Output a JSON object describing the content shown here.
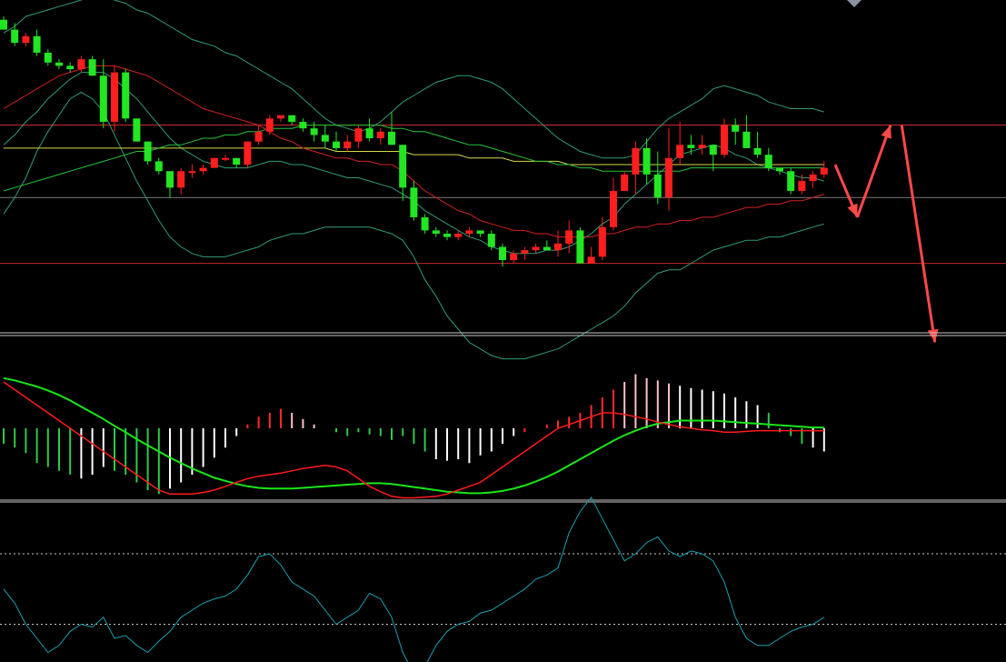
{
  "colors": {
    "background": "#000000",
    "up_candle": "#ff1e1e",
    "down_candle": "#22e622",
    "separator": "#c8c8c8",
    "horizontal_levels": "#c8282c",
    "mid_level": "#7a7a7a",
    "bollinger": "#2f9b74",
    "ma_red": "#d42020",
    "ma_green": "#22c43a",
    "ma_yellow": "#d8d84a",
    "dif": "#ff1a1a",
    "dea": "#19e619",
    "rsi": "#1aa0b0",
    "arrow": "#ff4848"
  },
  "chart_data": [
    {
      "type": "candlestick",
      "title": "",
      "xlabel": "",
      "ylabel": "",
      "ylim": [
        0,
        100
      ],
      "grid": false,
      "candles": [
        [
          94,
          91,
          95,
          91
        ],
        [
          91,
          87,
          93,
          86
        ],
        [
          87,
          89,
          90,
          86
        ],
        [
          89,
          84,
          91,
          83
        ],
        [
          84,
          81,
          85,
          80
        ],
        [
          81,
          80,
          82,
          79
        ],
        [
          80,
          79,
          81,
          78
        ],
        [
          79,
          82,
          83,
          78
        ],
        [
          82,
          77,
          83,
          77
        ],
        [
          77,
          63,
          82,
          61
        ],
        [
          63,
          78,
          80,
          60
        ],
        [
          78,
          64,
          79,
          63
        ],
        [
          64,
          57,
          64,
          57
        ],
        [
          57,
          51,
          57,
          50
        ],
        [
          51,
          48,
          52,
          47
        ],
        [
          48,
          43,
          48,
          40
        ],
        [
          43,
          48,
          49,
          41
        ],
        [
          48,
          48,
          50,
          46
        ],
        [
          48,
          49,
          50,
          47
        ],
        [
          49,
          52,
          52,
          49
        ],
        [
          52,
          52,
          53,
          51
        ],
        [
          52,
          50,
          52,
          49
        ],
        [
          50,
          57,
          57,
          49
        ],
        [
          57,
          60,
          62,
          56
        ],
        [
          60,
          64,
          65,
          59
        ],
        [
          64,
          65,
          65,
          63
        ],
        [
          65,
          63,
          65,
          62
        ],
        [
          63,
          61,
          64,
          60
        ],
        [
          61,
          59,
          63,
          57
        ],
        [
          59,
          57,
          62,
          55
        ],
        [
          57,
          55,
          60,
          54
        ],
        [
          55,
          57,
          59,
          54
        ],
        [
          57,
          61,
          62,
          55
        ],
        [
          61,
          58,
          64,
          57
        ],
        [
          58,
          60,
          61,
          56
        ],
        [
          60,
          56,
          66,
          56
        ],
        [
          56,
          43,
          56,
          39
        ],
        [
          43,
          34,
          45,
          33
        ],
        [
          34,
          30,
          35,
          29
        ],
        [
          30,
          29,
          31,
          28
        ],
        [
          29,
          28,
          30,
          27
        ],
        [
          28,
          29,
          30,
          27
        ],
        [
          29,
          30,
          31,
          28
        ],
        [
          30,
          29,
          30,
          28
        ],
        [
          29,
          25,
          30,
          24
        ],
        [
          25,
          21,
          26,
          19
        ],
        [
          21,
          23,
          24,
          20
        ],
        [
          23,
          24,
          25,
          21
        ],
        [
          24,
          25,
          26,
          23
        ],
        [
          25,
          24,
          27,
          24
        ],
        [
          24,
          26,
          30,
          22
        ],
        [
          26,
          30,
          33,
          23
        ],
        [
          30,
          20,
          31,
          20
        ],
        [
          20,
          22,
          25,
          22
        ],
        [
          22,
          31,
          34,
          21
        ],
        [
          31,
          42,
          46,
          30
        ],
        [
          42,
          47,
          48,
          43
        ],
        [
          47,
          55,
          57,
          41
        ],
        [
          55,
          47,
          58,
          44
        ],
        [
          47,
          40,
          54,
          38
        ],
        [
          40,
          52,
          61,
          36
        ],
        [
          52,
          56,
          63,
          50
        ],
        [
          56,
          55,
          59,
          53
        ],
        [
          55,
          56,
          59,
          53
        ],
        [
          56,
          53,
          55,
          48
        ],
        [
          53,
          62,
          64,
          52
        ],
        [
          62,
          60,
          64,
          56
        ],
        [
          60,
          55,
          65,
          59
        ],
        [
          55,
          53,
          60,
          52
        ],
        [
          53,
          49,
          55,
          48
        ],
        [
          49,
          48,
          49,
          47
        ],
        [
          48,
          42,
          49,
          41
        ],
        [
          42,
          45,
          47,
          41
        ],
        [
          45,
          47,
          48,
          43
        ],
        [
          47,
          49,
          51,
          46
        ]
      ],
      "overlays": {
        "bollinger_upper": [
          90,
          92,
          95,
          96,
          97,
          98,
          99,
          100,
          101,
          101,
          100,
          99,
          97,
          96,
          94,
          92,
          90,
          88,
          87,
          86,
          84,
          83,
          81,
          79,
          77,
          75,
          73,
          70,
          67,
          64,
          62,
          61,
          60,
          61,
          63,
          66,
          69,
          71,
          73,
          75,
          76,
          77,
          77,
          76,
          75,
          73,
          70,
          67,
          64,
          61,
          58,
          56,
          54,
          53,
          52,
          52,
          52,
          53,
          57,
          61,
          64,
          66,
          68,
          70,
          73,
          74,
          73,
          72,
          71,
          69,
          68,
          67,
          67,
          67,
          66
        ],
        "bollinger_mid": [
          56,
          59,
          63,
          66,
          70,
          73,
          76,
          78,
          78,
          78,
          76,
          73,
          70,
          66,
          62,
          58,
          55,
          53,
          51,
          50,
          49,
          49,
          49,
          50,
          51,
          51,
          50,
          50,
          49,
          48,
          47,
          46,
          46,
          45,
          44,
          43,
          41,
          39,
          36,
          34,
          32,
          30,
          28,
          27,
          25,
          24,
          23,
          23,
          23,
          24,
          24,
          25,
          27,
          29,
          32,
          34,
          38,
          41,
          44,
          47,
          50,
          53,
          54,
          55,
          56,
          55,
          53,
          52,
          50,
          49,
          48,
          47,
          46,
          46,
          45
        ],
        "bollinger_lower": [
          35,
          40,
          46,
          54,
          60,
          65,
          70,
          72,
          70,
          66,
          59,
          52,
          45,
          39,
          33,
          28,
          25,
          23,
          22,
          22,
          22,
          23,
          24,
          25,
          27,
          28,
          29,
          29,
          30,
          31,
          31,
          31,
          31,
          31,
          30,
          29,
          27,
          22,
          15,
          10,
          4,
          0,
          -4,
          -6,
          -8,
          -9,
          -9,
          -9,
          -8,
          -7,
          -6,
          -4,
          -2,
          0,
          2,
          4,
          7,
          11,
          14,
          17,
          18,
          18,
          20,
          22,
          24,
          25,
          26,
          27,
          27,
          28,
          28,
          29,
          30,
          31,
          32
        ],
        "ma_red": [
          67,
          69,
          71,
          73,
          75,
          77,
          78,
          79,
          80,
          80,
          80,
          79,
          78,
          77,
          75,
          73,
          71,
          69,
          67,
          66,
          65,
          64,
          63,
          62,
          60,
          58,
          57,
          55,
          54,
          53,
          52,
          52,
          51,
          51,
          50,
          50,
          48,
          45,
          42,
          40,
          38,
          36,
          35,
          33,
          32,
          31,
          30,
          30,
          29,
          29,
          28,
          28,
          28,
          28,
          29,
          29,
          30,
          31,
          31,
          32,
          32,
          33,
          33,
          34,
          34,
          35,
          36,
          37,
          37,
          38,
          38,
          39,
          39,
          40,
          41
        ],
        "ma_green": [
          42,
          43,
          44,
          45,
          46,
          47,
          48,
          49,
          50,
          51,
          52,
          53,
          54,
          54,
          55,
          56,
          56,
          57,
          58,
          58,
          59,
          59,
          60,
          60,
          61,
          61,
          61,
          62,
          62,
          62,
          62,
          62,
          62,
          62,
          62,
          61,
          61,
          60,
          60,
          59,
          58,
          57,
          56,
          56,
          55,
          54,
          53,
          52,
          51,
          51,
          50,
          50,
          49,
          49,
          48,
          48,
          48,
          48,
          48,
          48,
          48,
          48,
          49,
          49,
          49,
          49,
          49,
          49,
          49,
          49,
          49,
          49,
          49,
          49,
          49
        ],
        "ma_yellow": [
          55,
          55,
          55,
          55,
          55,
          55,
          55,
          55,
          55,
          55,
          55,
          55,
          55,
          55,
          55,
          55,
          55,
          55,
          55,
          55,
          55,
          55,
          55,
          55,
          55,
          55,
          55,
          55,
          55,
          55,
          54,
          54,
          54,
          54,
          54,
          54,
          54,
          53,
          53,
          53,
          53,
          53,
          52,
          52,
          52,
          52,
          51,
          51,
          51,
          51,
          51,
          50,
          50,
          50,
          50,
          50,
          50,
          50,
          50,
          50,
          50,
          50,
          50,
          50,
          50,
          50,
          50,
          50,
          50,
          50,
          50,
          50,
          50,
          50,
          50
        ]
      },
      "levels": [
        62,
        40,
        20
      ],
      "drawn_arrows": [
        [
          [
            75,
            50
          ],
          [
            77,
            34
          ]
        ],
        [
          [
            77,
            34
          ],
          [
            80,
            62
          ]
        ],
        [
          [
            81,
            62
          ],
          [
            84,
            -4
          ]
        ]
      ]
    },
    {
      "type": "bar",
      "title": "",
      "xlabel": "",
      "ylabel": "",
      "ylim": [
        -100,
        100
      ],
      "grid": false,
      "histogram": [
        -20,
        -25,
        -32,
        -45,
        -50,
        -55,
        -60,
        -65,
        -60,
        -50,
        -55,
        -60,
        -70,
        -80,
        -85,
        -78,
        -70,
        -60,
        -50,
        -38,
        -25,
        -10,
        5,
        15,
        20,
        25,
        20,
        12,
        5,
        0,
        -5,
        -10,
        -5,
        -8,
        -10,
        -15,
        -10,
        -20,
        -30,
        -40,
        -42,
        -40,
        -45,
        -35,
        -30,
        -20,
        -10,
        -5,
        0,
        5,
        10,
        15,
        20,
        30,
        40,
        50,
        60,
        70,
        65,
        62,
        58,
        55,
        52,
        50,
        48,
        45,
        40,
        35,
        30,
        20,
        -5,
        -10,
        -20,
        -25,
        -30
      ],
      "histogram_colors": [
        "g",
        "g",
        "g",
        "g",
        "g",
        "g",
        "g",
        "w",
        "w",
        "w",
        "g",
        "g",
        "g",
        "g",
        "g",
        "w",
        "w",
        "w",
        "w",
        "w",
        "w",
        "w",
        "r",
        "r",
        "r",
        "r",
        "p",
        "p",
        "p",
        "r",
        "g",
        "g",
        "g",
        "g",
        "g",
        "g",
        "g",
        "g",
        "g",
        "w",
        "w",
        "w",
        "w",
        "w",
        "w",
        "w",
        "w",
        "r",
        "r",
        "r",
        "r",
        "r",
        "r",
        "r",
        "r",
        "r",
        "p",
        "p",
        "p",
        "p",
        "p",
        "w",
        "w",
        "w",
        "w",
        "w",
        "w",
        "w",
        "w",
        "g",
        "g",
        "g",
        "g",
        "w",
        "w"
      ],
      "dif": [
        60,
        50,
        40,
        30,
        20,
        10,
        0,
        -10,
        -20,
        -30,
        -40,
        -50,
        -60,
        -70,
        -80,
        -85,
        -85,
        -85,
        -83,
        -80,
        -75,
        -70,
        -65,
        -62,
        -60,
        -58,
        -55,
        -52,
        -50,
        -48,
        -50,
        -55,
        -65,
        -75,
        -82,
        -88,
        -90,
        -90,
        -89,
        -88,
        -85,
        -80,
        -75,
        -70,
        -60,
        -50,
        -40,
        -30,
        -20,
        -10,
        0,
        5,
        10,
        15,
        20,
        20,
        18,
        15,
        12,
        8,
        5,
        2,
        0,
        -2,
        -3,
        -5,
        -5,
        -4,
        -3,
        -3,
        -3,
        -3,
        -3,
        -3,
        -3
      ],
      "dea": [
        65,
        62,
        58,
        54,
        49,
        43,
        36,
        28,
        20,
        12,
        3,
        -5,
        -14,
        -22,
        -30,
        -38,
        -45,
        -52,
        -58,
        -64,
        -68,
        -72,
        -75,
        -77,
        -78,
        -78,
        -78,
        -77,
        -76,
        -75,
        -74,
        -73,
        -72,
        -71,
        -71,
        -72,
        -74,
        -76,
        -78,
        -80,
        -82,
        -83,
        -84,
        -84,
        -83,
        -81,
        -78,
        -74,
        -69,
        -63,
        -56,
        -48,
        -40,
        -32,
        -24,
        -16,
        -9,
        -3,
        2,
        6,
        8,
        10,
        10,
        10,
        10,
        9,
        8,
        7,
        6,
        5,
        4,
        3,
        2,
        1,
        1
      ]
    },
    {
      "type": "line",
      "title": "",
      "xlabel": "",
      "ylabel": "",
      "ylim": [
        0,
        100
      ],
      "grid": false,
      "reference_lines": [
        80,
        30
      ],
      "rsi": [
        55,
        45,
        30,
        20,
        10,
        15,
        25,
        30,
        28,
        35,
        20,
        22,
        15,
        10,
        18,
        25,
        35,
        40,
        45,
        48,
        50,
        55,
        65,
        78,
        80,
        72,
        60,
        55,
        50,
        40,
        30,
        35,
        40,
        52,
        48,
        35,
        10,
        -5,
        0,
        15,
        25,
        30,
        32,
        38,
        40,
        45,
        50,
        55,
        62,
        65,
        70,
        95,
        110,
        120,
        105,
        90,
        75,
        80,
        88,
        92,
        82,
        78,
        82,
        80,
        75,
        60,
        35,
        20,
        15,
        15,
        20,
        25,
        28,
        30,
        35
      ]
    }
  ]
}
